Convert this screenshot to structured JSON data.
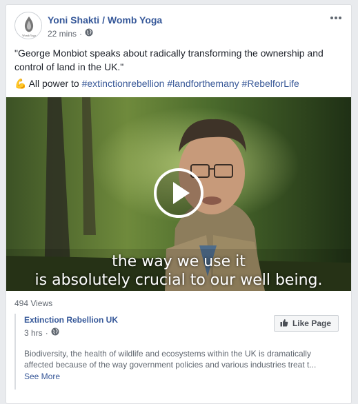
{
  "post": {
    "page_name": "Yoni Shakti / Womb Yoga",
    "time": "22 mins",
    "separator": "·",
    "privacy_icon": "globe-icon",
    "text_line1": "\"George Monbiot speaks about radically transforming the ownership and control of land in the UK.\"",
    "emoji": "💪",
    "text_line2_prefix": "All power to",
    "hashtags": [
      "#extinctionrebellion",
      "#landforthemany",
      "#RebelforLife"
    ]
  },
  "video": {
    "caption_line1": "the way we use it",
    "caption_line2": "is absolutely crucial to our well being.",
    "play_icon": "play-icon"
  },
  "views": "494 Views",
  "shared": {
    "page_name": "Extinction Rebellion UK",
    "time": "3 hrs",
    "separator": "·",
    "like_button_label": "Like Page",
    "description": "Biodiversity, the health of wildlife and ecosystems within the UK is dramatically affected because of the way government policies and various industries treat t...",
    "see_more": "See More"
  }
}
